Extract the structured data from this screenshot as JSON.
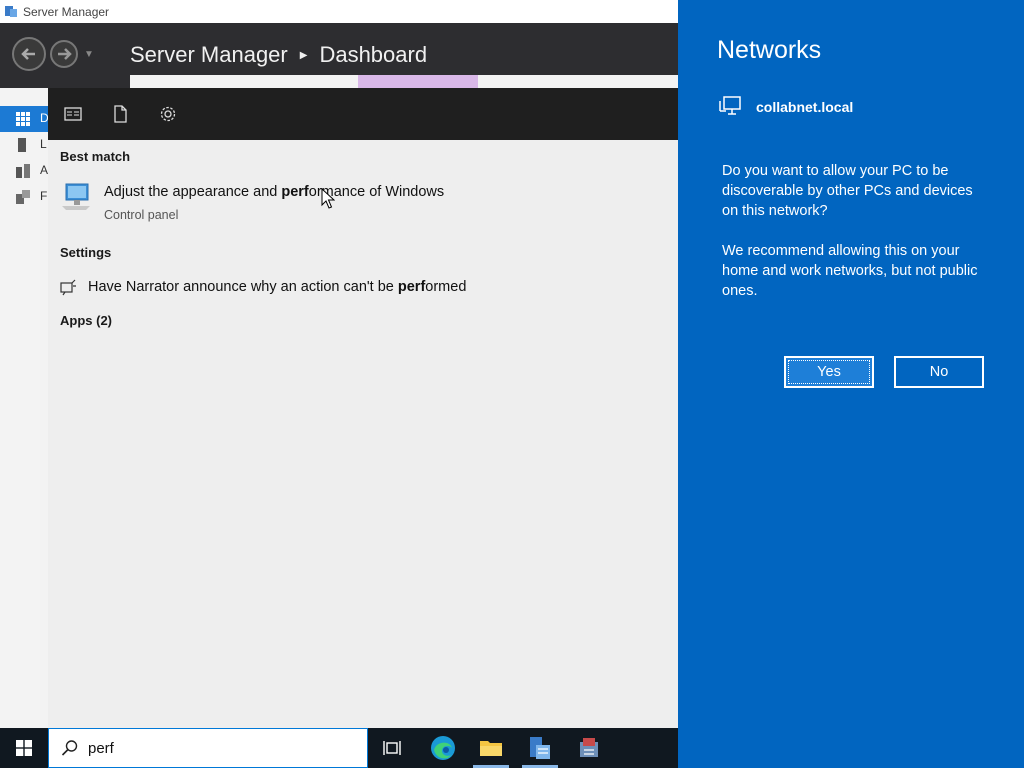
{
  "server_manager": {
    "window_title": "Server Manager",
    "breadcrumb_app": "Server Manager",
    "breadcrumb_page": "Dashboard",
    "sidebar_letters": [
      "D",
      "L",
      "A",
      "F"
    ]
  },
  "search_panel": {
    "best_match_heading": "Best match",
    "best_match": {
      "title_before": "Adjust the appearance and ",
      "title_bold": "perf",
      "title_after": "ormance of Windows",
      "subtitle": "Control panel"
    },
    "settings_heading": "Settings",
    "settings_item": {
      "title_before": "Have Narrator announce why an action can't be ",
      "title_bold": "perf",
      "title_after": "ormed"
    },
    "apps_heading": "Apps (2)"
  },
  "networks": {
    "title": "Networks",
    "network_name": "collabnet.local",
    "question": "Do you want to allow your PC to be discoverable by other PCs and devices on this network?",
    "recommendation": "We recommend allowing this on your home and work networks, but not public ones.",
    "yes_label": "Yes",
    "no_label": "No"
  },
  "taskbar": {
    "search_query": "perf"
  },
  "colors": {
    "accent": "#0165c0",
    "taskbar": "#101820",
    "panel_bg": "#eeeeee"
  }
}
